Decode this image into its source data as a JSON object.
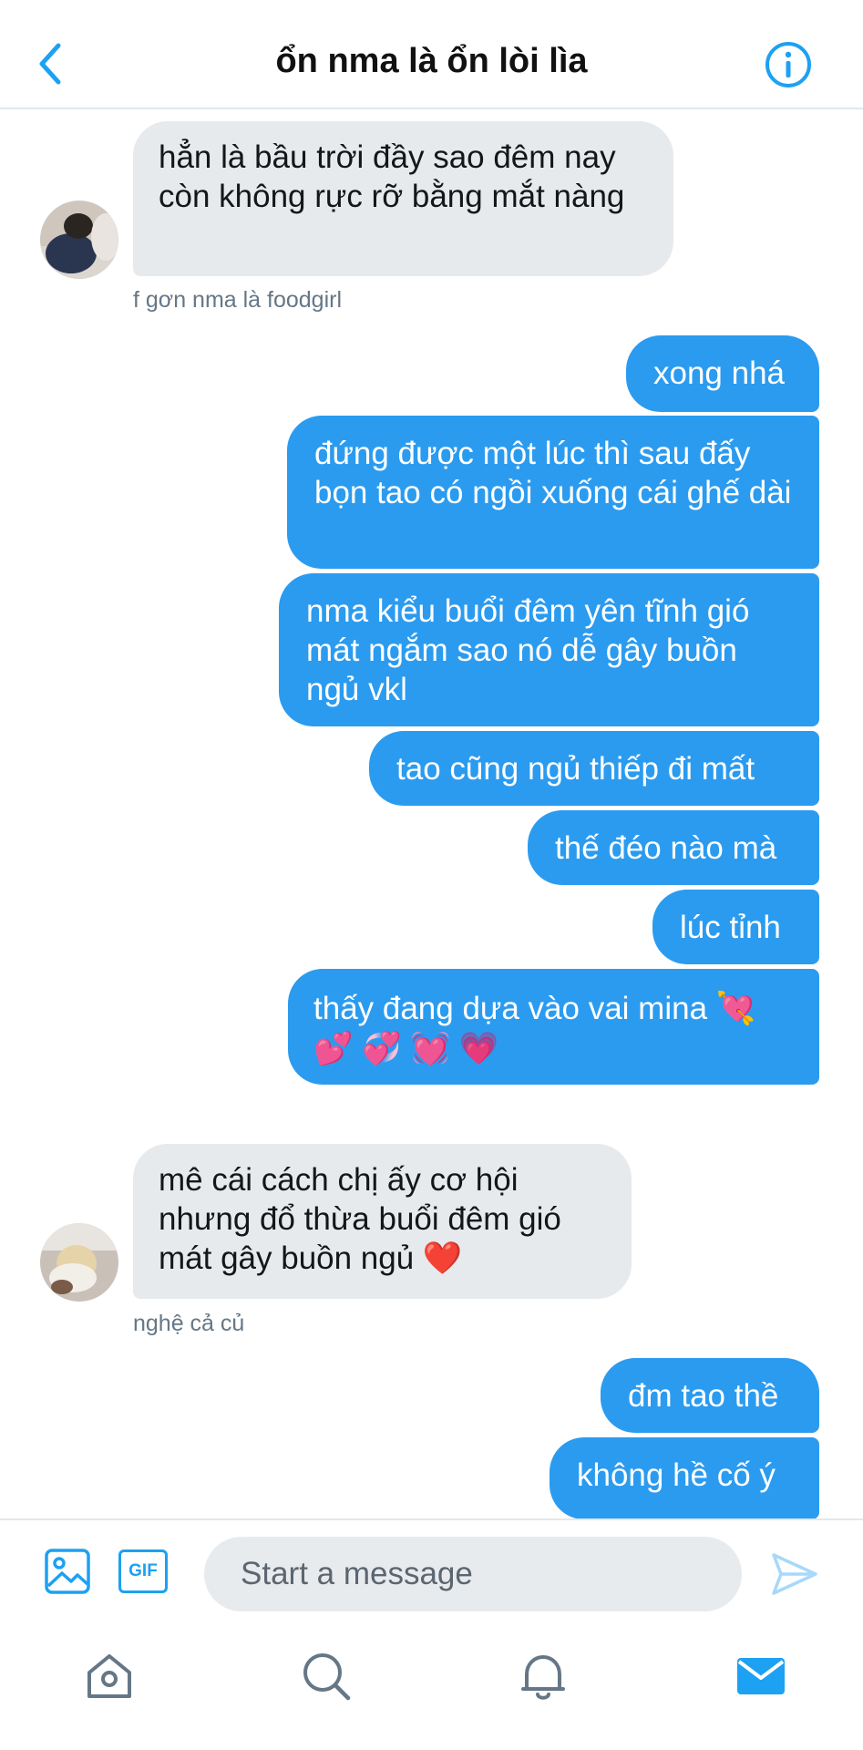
{
  "header": {
    "title": "ổn nma là ổn lòi lìa",
    "back_icon": "chevron-left-icon",
    "info_icon": "info-icon"
  },
  "messages": [
    {
      "side": "in",
      "text": "hẳn là bầu trời đầy sao đêm nay còn không rực rỡ bằng mắt nàng",
      "sender": "f gơn nma là foodgirl"
    },
    {
      "side": "out",
      "text": "xong nhá"
    },
    {
      "side": "out",
      "text": "đứng được một lúc thì sau đấy bọn tao có ngồi xuống cái ghế dài"
    },
    {
      "side": "out",
      "text": "nma kiểu buổi đêm yên tĩnh gió mát ngắm sao nó dễ gây buồn ngủ vkl"
    },
    {
      "side": "out",
      "text": "tao cũng ngủ thiếp đi mất"
    },
    {
      "side": "out",
      "text": "thế đéo nào mà"
    },
    {
      "side": "out",
      "text": "lúc tỉnh"
    },
    {
      "side": "out",
      "text": "thấy đang dựa vào vai mina 💘 💕 💞 💓 💗"
    },
    {
      "side": "in",
      "text": "mê cái cách chị ấy cơ hội nhưng đổ thừa buổi đêm gió mát gây buồn ngủ ❤️",
      "sender": "nghệ cả củ"
    },
    {
      "side": "out",
      "text": "đm tao thề"
    },
    {
      "side": "out",
      "text": "không hề cố ý"
    }
  ],
  "composer": {
    "placeholder": "Start a message",
    "image_icon": "image-icon",
    "gif_label": "GIF",
    "send_icon": "send-icon"
  },
  "tabbar": {
    "items": [
      "home-icon",
      "search-icon",
      "notifications-icon",
      "messages-icon"
    ]
  },
  "colors": {
    "accent": "#1da1f2",
    "outgoing_bubble": "#2b9bf0",
    "incoming_bubble": "#e7eaed",
    "meta_text": "#657786"
  }
}
